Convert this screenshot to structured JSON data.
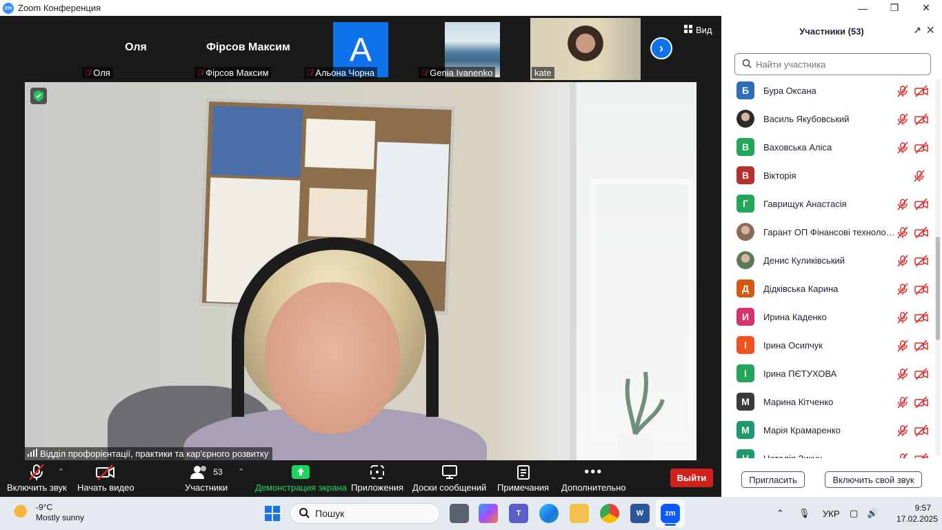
{
  "window": {
    "title": "Zoom Конференция",
    "logo": "zm"
  },
  "strip": {
    "tiles": [
      {
        "display_name": "Оля",
        "label": "Оля"
      },
      {
        "display_name": "Фірсов Максим",
        "label": "Фірсов Максим"
      },
      {
        "avatar_letter": "A",
        "label": "Альона Чорна"
      },
      {
        "label": "Genia Ivanenko"
      },
      {
        "label": "kate"
      }
    ],
    "view_label": "Вид"
  },
  "main_video": {
    "speaker_label": "Відділ профорієнтації, практики та кар'єрного розвитку"
  },
  "toolbar": {
    "unmute_label": "Включить звук",
    "start_video_label": "Начать видео",
    "participants_label": "Участники",
    "participants_count": "53",
    "share_label": "Демонстрация экрана",
    "apps_label": "Приложения",
    "whiteboards_label": "Доски сообщений",
    "notes_label": "Примечания",
    "more_label": "Дополнительно",
    "leave_label": "Выйти",
    "share_color": "#1bd65a",
    "leave_color": "#d0221a"
  },
  "panel": {
    "title": "Участники (53)",
    "search_placeholder": "Найти участника",
    "participants": [
      {
        "initial": "Б",
        "name": "Бура Оксана",
        "color": "#2d6fb6",
        "video_off": true
      },
      {
        "initial": "",
        "name": "Василь Якубовський",
        "color": "#2b2b2b",
        "photo": true,
        "video_off": true
      },
      {
        "initial": "В",
        "name": "Ваховська Аліса",
        "color": "#23a55a",
        "video_off": true
      },
      {
        "initial": "В",
        "name": "Вікторія",
        "color": "#b8302b",
        "video_off": false
      },
      {
        "initial": "Г",
        "name": "Гаврищук Анастасія",
        "color": "#23a55a",
        "video_off": true
      },
      {
        "initial": "",
        "name": "Гарант ОП Фінансові технологі...",
        "color": "#8a6a5a",
        "photo": true,
        "video_off": true
      },
      {
        "initial": "",
        "name": "Денис Куликівський",
        "color": "#5a7a5a",
        "photo": true,
        "video_off": true
      },
      {
        "initial": "Д",
        "name": "Дідківська Карина",
        "color": "#d45a12",
        "video_off": true
      },
      {
        "initial": "И",
        "name": "Ирина Каденко",
        "color": "#d6336c",
        "video_off": true
      },
      {
        "initial": "І",
        "name": "Ірина Осипчук",
        "color": "#f0531c",
        "video_off": true
      },
      {
        "initial": "І",
        "name": "Ірина ПЄТУХОВА",
        "color": "#23a55a",
        "video_off": true
      },
      {
        "initial": "М",
        "name": "Марина Кітченко",
        "color": "#3a3a3a",
        "video_off": true
      },
      {
        "initial": "М",
        "name": "Марія Крамаренко",
        "color": "#1e9a6a",
        "video_off": true
      },
      {
        "initial": "Н",
        "name": "Наталія Зикун",
        "color": "#1e9a6a",
        "video_off": true
      }
    ],
    "invite_label": "Пригласить",
    "unmute_self_label": "Включить свой звук"
  },
  "taskbar": {
    "weather_temp": "-9°C",
    "weather_desc": "Mostly sunny",
    "search_placeholder": "Пошук",
    "lang": "УКР",
    "time": "9:57",
    "date": "17.02.2025"
  }
}
